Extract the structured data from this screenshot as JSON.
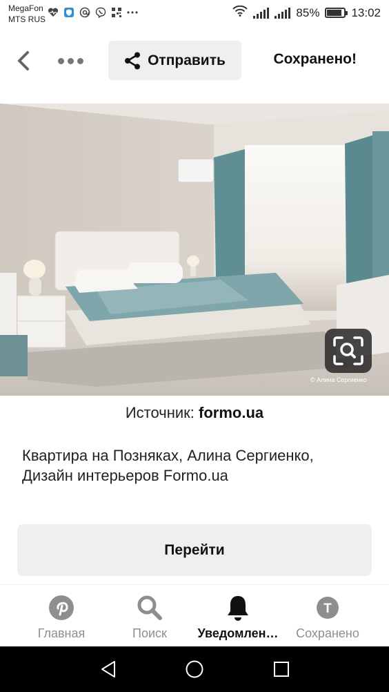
{
  "status_bar": {
    "carrier_line1": "MegaFon",
    "carrier_line2": "MTS RUS",
    "battery_percent": "85%",
    "time": "13:02",
    "battery_level": 0.85,
    "left_icons": [
      "heart-monitor-icon",
      "shield-icon",
      "at-icon",
      "viber-icon",
      "qr-icon",
      "more-dots-icon"
    ]
  },
  "top_bar": {
    "send_label": "Отправить",
    "saved_label": "Сохранено!"
  },
  "image": {
    "watermark": "© Алина Сергиенко"
  },
  "source": {
    "prefix": "Источник: ",
    "domain": "formo.ua"
  },
  "description": "Квартира на Позняках, Алина Сергиенко, Дизайн интерьеров Formo.ua",
  "go_button_label": "Перейти",
  "bottom_nav": {
    "items": [
      {
        "label": "Главная",
        "icon": "pinterest-icon",
        "active": false
      },
      {
        "label": "Поиск",
        "icon": "search-icon",
        "active": false
      },
      {
        "label": "Уведомлен…",
        "icon": "bell-icon",
        "active": true
      },
      {
        "label": "Сохранено",
        "icon": "profile-icon",
        "active": false
      }
    ],
    "profile_initial": "T"
  },
  "colors": {
    "button_bg": "#efefef",
    "inactive": "#8e8e8e",
    "active": "#111111"
  }
}
